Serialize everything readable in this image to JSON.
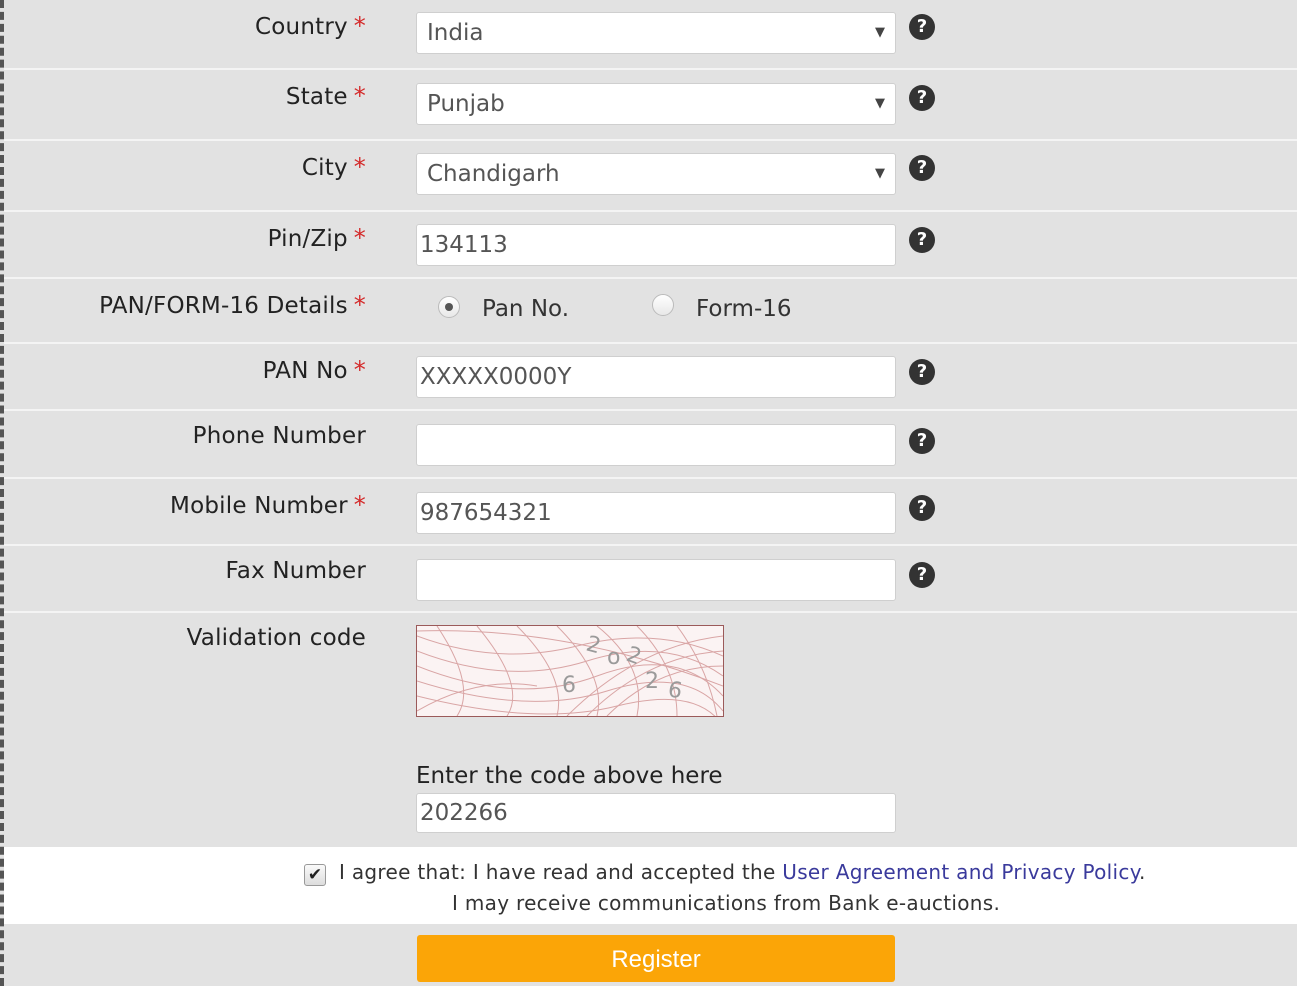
{
  "form": {
    "country": {
      "label": "Country",
      "value": "India"
    },
    "state": {
      "label": "State",
      "value": "Punjab"
    },
    "city": {
      "label": "City",
      "value": "Chandigarh"
    },
    "pin": {
      "label": "Pin/Zip",
      "value": "134113"
    },
    "pan_form": {
      "label": "PAN/FORM-16 Details",
      "option_pan": "Pan No.",
      "option_form16": "Form-16",
      "selected": "Pan No."
    },
    "pan_no": {
      "label": "PAN No",
      "value": "XXXXX0000Y"
    },
    "phone": {
      "label": "Phone Number",
      "value": ""
    },
    "mobile": {
      "label": "Mobile Number",
      "value": "987654321"
    },
    "fax": {
      "label": "Fax Number",
      "value": ""
    },
    "validation": {
      "label": "Validation code",
      "captcha_text": "202266",
      "enter_label": "Enter the code above here",
      "value": "202266"
    },
    "required_mark": "*",
    "help_glyph": "?",
    "select_arrow": "▼"
  },
  "agreement": {
    "checked": true,
    "check_glyph": "✔",
    "text_prefix": "I agree that: I have read and accepted the ",
    "link_text": "User Agreement and Privacy Policy",
    "text_suffix": ".",
    "line2": "I may receive communications from Bank e-auctions."
  },
  "register_label": "Register",
  "colors": {
    "required": "#d42a2a",
    "register_button": "#fba507",
    "link": "#3a3a9c",
    "row_background": "#e2e2e2"
  }
}
